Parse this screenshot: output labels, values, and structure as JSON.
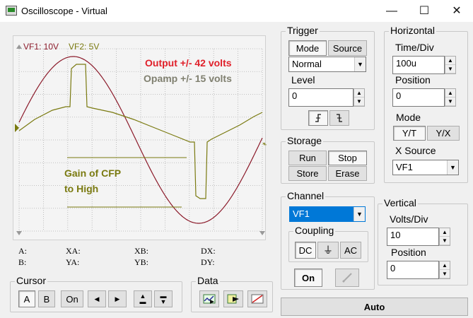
{
  "window": {
    "title": "Oscilloscope - Virtual",
    "minimize": "—",
    "maximize": "☐",
    "close": "✕"
  },
  "scope": {
    "vf1_label": "VF1: 10V",
    "vf2_label": "VF2: 5V",
    "annotation_output": "Output +/- 42 volts",
    "annotation_opamp": "Opamp +/- 15 volts",
    "annotation_gain_1": "Gain of CFP",
    "annotation_gain_2": "to High",
    "colors": {
      "vf1": "#8b1a2a",
      "vf2": "#7a7a10",
      "grid": "#b0b0b0",
      "output_text": "#e0202a",
      "opamp_text": "#808070"
    }
  },
  "readouts": {
    "a": "A:",
    "b": "B:",
    "xa": "XA:",
    "ya": "YA:",
    "xb": "XB:",
    "yb": "YB:",
    "dx": "DX:",
    "dy": "DY:"
  },
  "trigger": {
    "title": "Trigger",
    "mode_btn": "Mode",
    "source_btn": "Source",
    "mode_value": "Normal",
    "level_label": "Level",
    "level_value": "0"
  },
  "horizontal": {
    "title": "Horizontal",
    "time_div_label": "Time/Div",
    "time_div_value": "100u",
    "position_label": "Position",
    "position_value": "0",
    "mode_label": "Mode",
    "yt_btn": "Y/T",
    "yx_btn": "Y/X",
    "xsource_label": "X Source",
    "xsource_value": "VF1"
  },
  "storage": {
    "title": "Storage",
    "run": "Run",
    "stop": "Stop",
    "store": "Store",
    "erase": "Erase"
  },
  "channel": {
    "title": "Channel",
    "selected": "VF1",
    "coupling_title": "Coupling",
    "dc": "DC",
    "ac": "AC",
    "on": "On"
  },
  "vertical": {
    "title": "Vertical",
    "volts_div_label": "Volts/Div",
    "volts_div_value": "10",
    "position_label": "Position",
    "position_value": "0"
  },
  "cursor": {
    "title": "Cursor",
    "a": "A",
    "b": "B",
    "on": "On"
  },
  "data_group": {
    "title": "Data"
  },
  "auto_btn": "Auto"
}
